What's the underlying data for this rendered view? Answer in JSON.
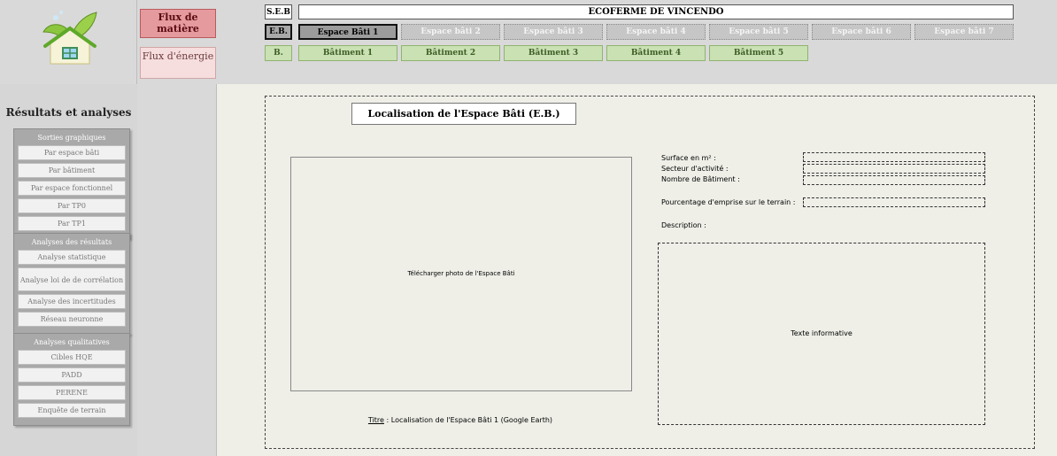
{
  "sidebar_top": {
    "flux_matiere": "Flux de matière",
    "flux_energie": "Flux d'énergie"
  },
  "header": {
    "seb_code": "S.E.B",
    "title": "ECOFERME DE VINCENDO",
    "eb_code": "E.B.",
    "b_code": "B.",
    "eb_tabs": [
      {
        "label": "Espace Bâti 1",
        "active": true
      },
      {
        "label": "Espace bâti 2"
      },
      {
        "label": "Espace bâti 3"
      },
      {
        "label": "Espace bâti 4"
      },
      {
        "label": "Espace bâti 5"
      },
      {
        "label": "Espace bâti 6"
      },
      {
        "label": "Espace bâti 7"
      }
    ],
    "b_tabs": [
      {
        "label": "Bâtiment 1"
      },
      {
        "label": "Bâtiment 2"
      },
      {
        "label": "Bâtiment 3"
      },
      {
        "label": "Bâtiment 4"
      },
      {
        "label": "Bâtiment 5"
      }
    ]
  },
  "left_panel": {
    "title": "Résultats et analyses",
    "groups": [
      {
        "title": "Sorties graphiques",
        "items": [
          "Par espace bâti",
          "Par bâtiment",
          "Par espace fonctionnel",
          "Par TP0",
          "Par TP1"
        ]
      },
      {
        "title": "Analyses des résultats",
        "items": [
          "Analyse statistique",
          "Analyse loi de de corrélation",
          "Analyse des incertitudes",
          "Réseau neuronne"
        ]
      },
      {
        "title": "Analyses qualitatives",
        "items": [
          "Cibles HQE",
          "PADD",
          "PERENE",
          "Enquête de terrain"
        ]
      }
    ]
  },
  "main": {
    "section_title": "Localisation de l'Espace Bâti (E.B.)",
    "photo_placeholder": "Télécharger photo de l'Espace Bâti",
    "caption_label": "Titre",
    "caption_text": " : Localisation de l'Espace Bâti 1 (Google Earth)",
    "fields": {
      "surface": "Surface en m² :",
      "secteur": "Secteur d'activité :",
      "nombre": "Nombre de Bâtiment :",
      "emprise": "Pourcentage d'emprise sur le terrain :",
      "description": "Description :"
    },
    "description_placeholder": "Texte informative"
  },
  "colors": {
    "flux_matiere_bg": "#e59a9e",
    "flux_energie_bg": "#f7dede",
    "batiment_tab_bg": "#c9e1b3",
    "work_bg": "#efefe8"
  }
}
